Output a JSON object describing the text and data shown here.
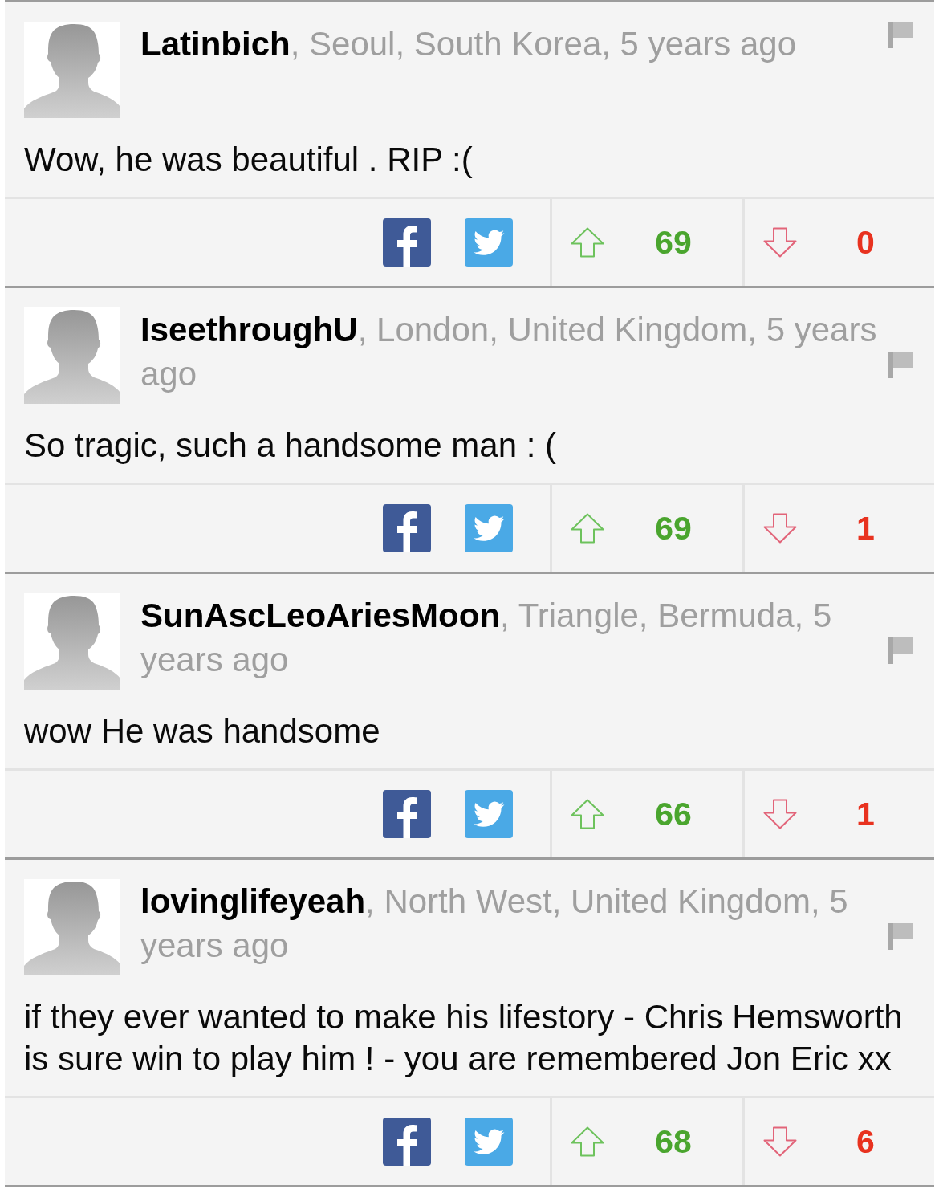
{
  "comments": [
    {
      "header": "**Latinbich**, Seoul, South Korea, 5 years ago",
      "text": "Wow, he was beautiful . RIP :(",
      "upvotes": "69",
      "downvotes": "0"
    },
    {
      "header": "**IseethroughU**, London, United Kingdom, 5 years ago",
      "text": "So tragic, such a handsome man : (",
      "upvotes": "69",
      "downvotes": "1"
    },
    {
      "header": "**SunAscLeoAriesMoon**, Triangle, Bermuda, 5 years ago",
      "text": "wow He was handsome",
      "upvotes": "66",
      "downvotes": "1"
    },
    {
      "header": "**lovinglifeyeah**, North West, United Kingdom, 5 years ago",
      "text": "if they ever wanted to make his lifestory - Chris Hemsworth is sure win to play him ! - you are remembered Jon Eric xx",
      "upvotes": "68",
      "downvotes": "6"
    }
  ]
}
